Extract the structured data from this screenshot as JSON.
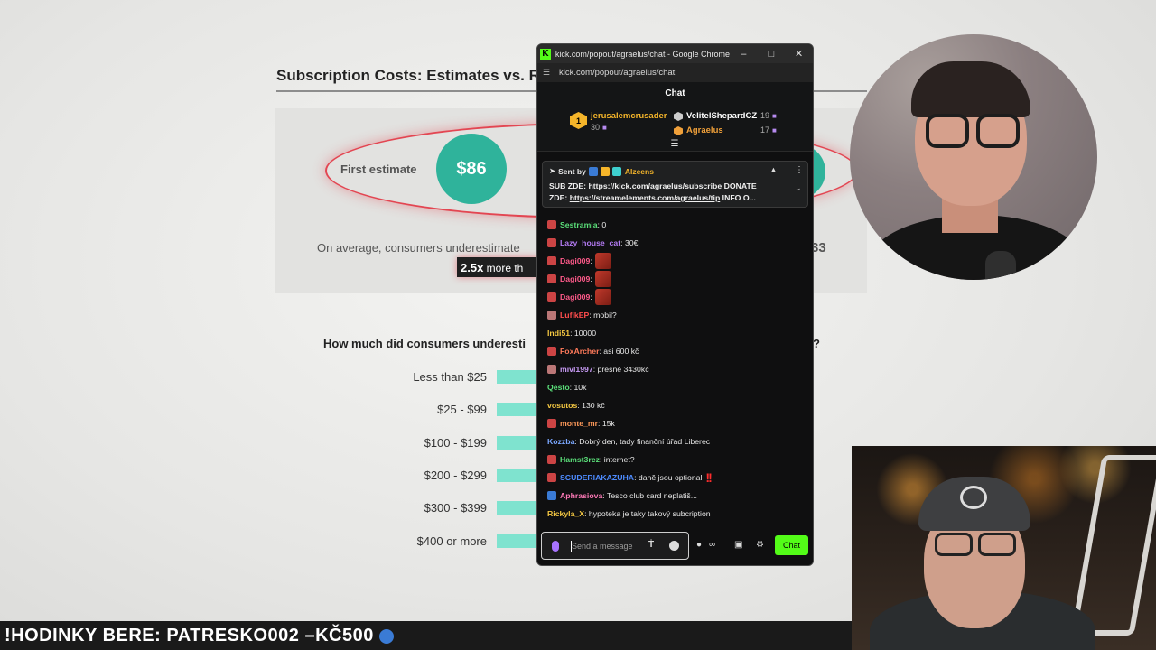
{
  "slide": {
    "title": "Subscription Costs: Estimates vs. Re",
    "first_label": "First estimate",
    "first_amount": "$86",
    "average_text": "On average, consumers underestimate",
    "average_num": "33",
    "pill_bold": "2.5x",
    "pill_rest": " more th",
    "question": "How much did consumers underesti",
    "question_end": "?",
    "ranges": [
      "Less than $25",
      "$25 - $99",
      "$100 - $199",
      "$200 - $299",
      "$300 - $399",
      "$400 or more"
    ]
  },
  "ticker": {
    "text": "!HODINKY BERE: PATRESKO002 –KČ500"
  },
  "browser": {
    "title": "kick.com/popout/agraelus/chat - Google Chrome",
    "url": "kick.com/popout/agraelus/chat"
  },
  "chat": {
    "header": "Chat",
    "leaderboard": [
      {
        "rank": "1",
        "name": "jerusalemcrusader",
        "count": "30"
      },
      {
        "name": "VelitelShepardCZ",
        "count": "19"
      },
      {
        "name": "Agraelus",
        "count": "17"
      }
    ],
    "pinned": {
      "sent_by": "Sent by",
      "user": "Alzeens",
      "line1_pre": "SUB ZDE: ",
      "line1_link": "https://kick.com/agraelus/subscribe",
      "line1_post": " DONATE",
      "line2_pre": "ZDE: ",
      "line2_link": "https://streamelements.com/agraelus/tip",
      "line2_post": " INFO O..."
    },
    "messages": [
      {
        "user": "Sestramia",
        "text": ": 0",
        "color": "#5be07a",
        "badge": "#c44"
      },
      {
        "user": "Lazy_house_cat",
        "text": ": 30€",
        "color": "#b57cf5",
        "badge": "#c44"
      },
      {
        "user": "Dagi009",
        "text": ":",
        "color": "#ff5a8a",
        "badge": "#c44",
        "emote": true
      },
      {
        "user": "Dagi009",
        "text": ":",
        "color": "#ff5a8a",
        "badge": "#c44",
        "emote": true
      },
      {
        "user": "Dagi009",
        "text": ":",
        "color": "#ff5a8a",
        "badge": "#c44",
        "emote": true
      },
      {
        "user": "LufikEP",
        "text": ": mobil?",
        "color": "#ff4d4d",
        "badge": "#b77"
      },
      {
        "user": "Indi51",
        "text": ": 10000",
        "color": "#f5c842",
        "badge": ""
      },
      {
        "user": "FoxArcher",
        "text": ": asi 600 kč",
        "color": "#ff7a5a",
        "badge": "#c44"
      },
      {
        "user": "mivl1997",
        "text": ": přesně 3430kč",
        "color": "#c99cf7",
        "badge": "#b77"
      },
      {
        "user": "Qesto",
        "text": ": 10k",
        "color": "#5be07a",
        "badge": ""
      },
      {
        "user": "vosutos",
        "text": ": 130 kč",
        "color": "#f5c842",
        "badge": ""
      },
      {
        "user": "monte_mr",
        "text": ": 15k",
        "color": "#ff9a5a",
        "badge": "#c44"
      },
      {
        "user": "Kozzba",
        "text": ": Dobrý den, tady finanční úřad Liberec",
        "color": "#7aa7ff",
        "badge": ""
      },
      {
        "user": "Hamst3rcz",
        "text": ": internet?",
        "color": "#5be07a",
        "badge": "#c44"
      },
      {
        "user": "SCUDERIAKAZUHA",
        "text": ": daně jsou optional",
        "color": "#4d8bff",
        "badge": "#c44",
        "excl": "!!"
      },
      {
        "user": "Aphrasiova",
        "text": ": Tesco club card neplatiš...",
        "color": "#ff7ab8",
        "badge": "#3a7bd5"
      },
      {
        "user": "Rickyla_X",
        "text": ": hypoteka je taky takový subcription",
        "color": "#f5c842",
        "badge": ""
      }
    ],
    "input_placeholder": "Send a message",
    "send_label": "Chat"
  }
}
